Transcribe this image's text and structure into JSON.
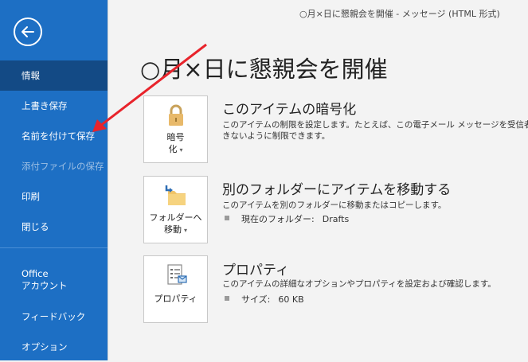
{
  "window": {
    "title": "○月×日に懇親会を開催  -  メッセージ (HTML 形式)"
  },
  "sidebar": {
    "items": [
      {
        "label": "情報"
      },
      {
        "label": "上書き保存"
      },
      {
        "label": "名前を付けて保存"
      },
      {
        "label": "添付ファイルの保存"
      },
      {
        "label": "印刷"
      },
      {
        "label": "閉じる"
      },
      {
        "label_line1": "Office",
        "label_line2": "アカウント"
      },
      {
        "label": "フィードバック"
      },
      {
        "label": "オプション"
      }
    ]
  },
  "main": {
    "title": "○月×日に懇親会を開催",
    "sections": [
      {
        "tile_line1": "暗号",
        "tile_line2": "化",
        "heading": "このアイテムの暗号化",
        "desc_line1": "このアイテムの制限を設定します。たとえば、この電子メール メッセージを受信者が他",
        "desc_line2": "きないように制限できます。"
      },
      {
        "tile_line1": "フォルダーへ",
        "tile_line2": "移動",
        "heading": "別のフォルダーにアイテムを移動する",
        "desc": "このアイテムを別のフォルダーに移動またはコピーします。",
        "bullet_label": "現在のフォルダー:",
        "bullet_value": "Drafts"
      },
      {
        "tile_label": "プロパティ",
        "heading": "プロパティ",
        "desc": "このアイテムの詳細なオプションやプロパティを設定および確認します。",
        "bullet_label": "サイズ:",
        "bullet_value": "60 KB"
      }
    ]
  },
  "colors": {
    "sidebar_bg": "#1d6fc4",
    "sidebar_selected": "#134a85",
    "annotation_arrow": "#e8232b"
  }
}
